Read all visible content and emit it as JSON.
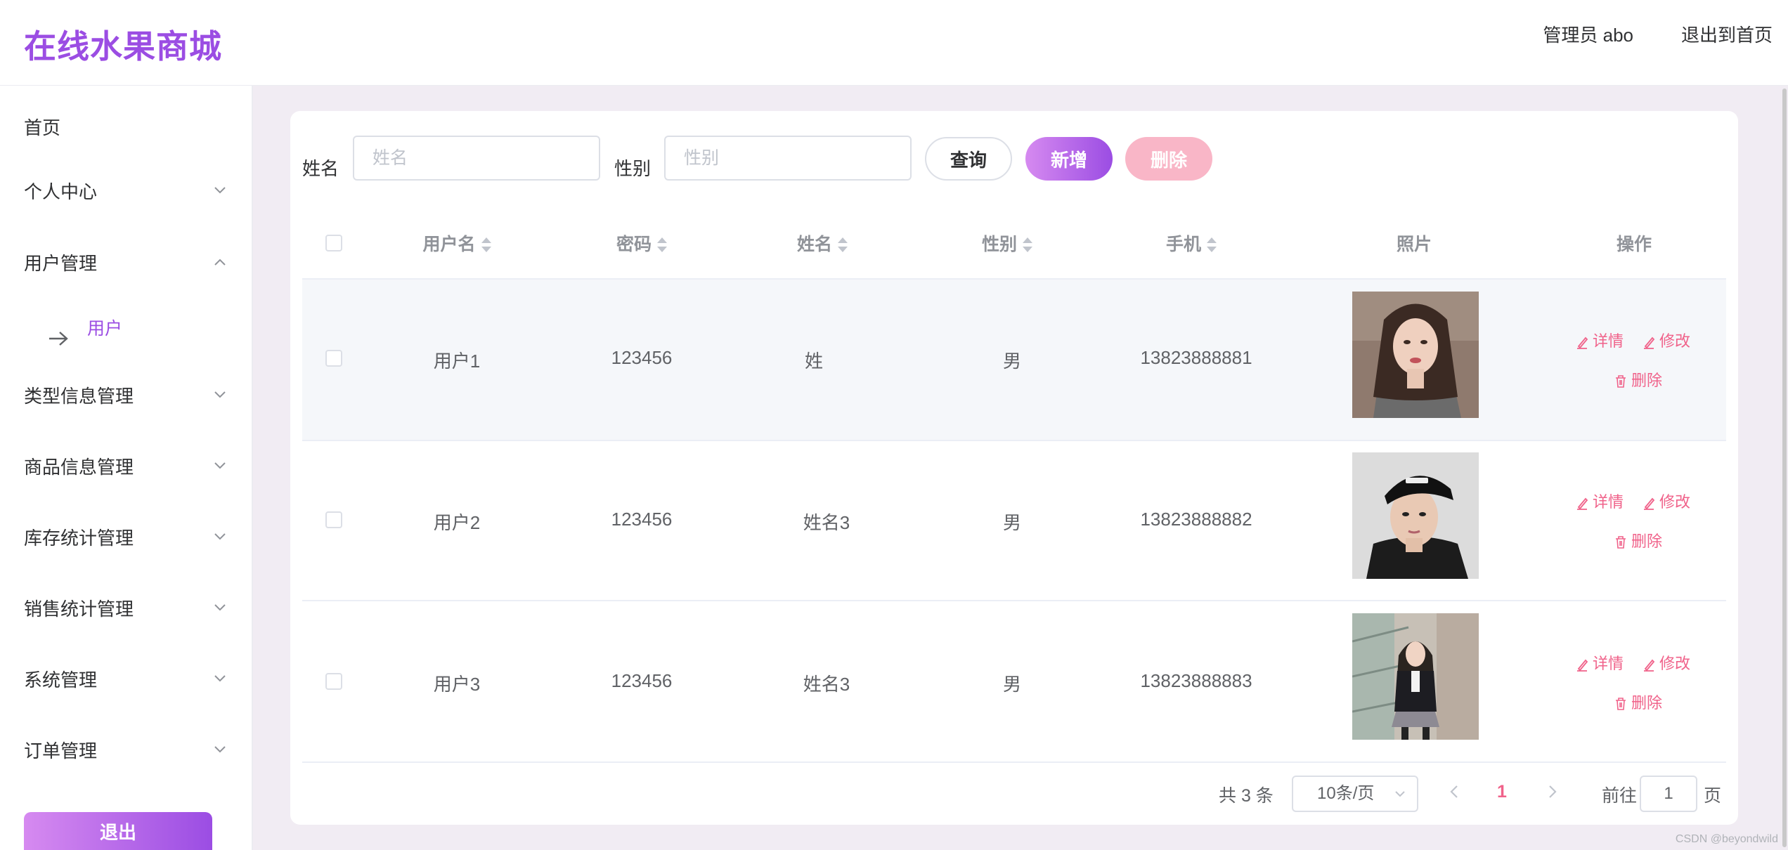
{
  "app": {
    "title": "在线水果商城"
  },
  "header": {
    "admin_label": "管理员 abo",
    "exit_home": "退出到首页"
  },
  "sidebar": {
    "items": [
      {
        "label": "首页",
        "expanded": false,
        "has_children": false
      },
      {
        "label": "个人中心",
        "expanded": false,
        "has_children": true
      },
      {
        "label": "用户管理",
        "expanded": true,
        "has_children": true
      },
      {
        "label": "类型信息管理",
        "expanded": false,
        "has_children": true
      },
      {
        "label": "商品信息管理",
        "expanded": false,
        "has_children": true
      },
      {
        "label": "库存统计管理",
        "expanded": false,
        "has_children": true
      },
      {
        "label": "销售统计管理",
        "expanded": false,
        "has_children": true
      },
      {
        "label": "系统管理",
        "expanded": false,
        "has_children": true
      },
      {
        "label": "订单管理",
        "expanded": false,
        "has_children": true
      }
    ],
    "sub_item": {
      "label": "用户"
    },
    "logout": "退出"
  },
  "search": {
    "name_label": "姓名",
    "name_placeholder": "姓名",
    "name_value": "",
    "gender_label": "性别",
    "gender_placeholder": "性别",
    "gender_value": "",
    "query": "查询",
    "add": "新增",
    "delete": "删除"
  },
  "table": {
    "headers": [
      "用户名",
      "密码",
      "姓名",
      "性别",
      "手机",
      "照片",
      "操作"
    ],
    "rows": [
      {
        "username": "用户1",
        "password": "123456",
        "name": "姓",
        "gender": "男",
        "phone": "13823888881",
        "photo": "woman-portrait",
        "selected": false
      },
      {
        "username": "用户2",
        "password": "123456",
        "name": "姓名3",
        "gender": "男",
        "phone": "13823888882",
        "photo": "man-cap-portrait",
        "selected": false
      },
      {
        "username": "用户3",
        "password": "123456",
        "name": "姓名3",
        "gender": "男",
        "phone": "13823888883",
        "photo": "girl-stairs-portrait",
        "selected": false
      }
    ],
    "actions": {
      "detail": "详情",
      "edit": "修改",
      "delete": "删除"
    }
  },
  "pagination": {
    "total": "共 3 条",
    "page_size": "10条/页",
    "current_page": "1",
    "goto_label": "前往",
    "goto_value": "1",
    "page_suffix": "页"
  },
  "watermark": "CSDN @beyondwild",
  "colors": {
    "accent": "#9b4de3",
    "danger": "#f0628a",
    "background": "#f1ecf3"
  }
}
